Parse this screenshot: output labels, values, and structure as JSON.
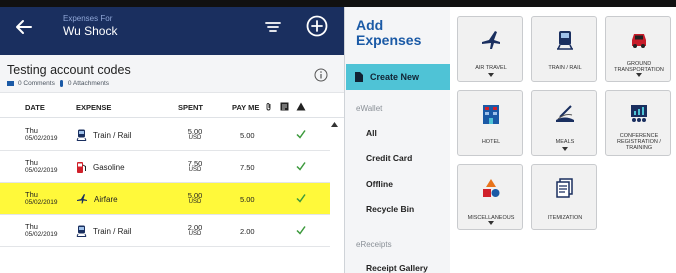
{
  "header": {
    "subtitle": "Expenses For",
    "user_name": "Wu Shock"
  },
  "report": {
    "title": "Testing account codes",
    "comments": "0 Comments",
    "attachments": "0 Attachments"
  },
  "table": {
    "columns": [
      "DATE",
      "EXPENSE",
      "SPENT",
      "PAY ME"
    ],
    "rows": [
      {
        "day": "Thu",
        "date": "05/02/2019",
        "expense": "Train / Rail",
        "icon": "train-icon",
        "spent": "5.00",
        "currency": "USD",
        "pay_me": "5.00",
        "highlight": false
      },
      {
        "day": "Thu",
        "date": "05/02/2019",
        "expense": "Gasoline",
        "icon": "gas-pump-icon",
        "spent": "7.50",
        "currency": "USD",
        "pay_me": "7.50",
        "highlight": false
      },
      {
        "day": "Thu",
        "date": "05/02/2019",
        "expense": "Airfare",
        "icon": "airplane-icon",
        "spent": "5.00",
        "currency": "USD",
        "pay_me": "5.00",
        "highlight": true
      },
      {
        "day": "Thu",
        "date": "05/02/2019",
        "expense": "Train / Rail",
        "icon": "train-icon",
        "spent": "2.00",
        "currency": "USD",
        "pay_me": "2.00",
        "highlight": false
      }
    ]
  },
  "nav": {
    "heading_line1": "Add",
    "heading_line2": "Expenses",
    "create_new": "Create New",
    "ewallet_section": "eWallet",
    "ewallet_items": [
      "All",
      "Credit Card",
      "Offline",
      "Recycle Bin"
    ],
    "ereceipts_section": "eReceipts",
    "ereceipts_items": [
      "Receipt Gallery"
    ]
  },
  "tiles": [
    {
      "label": "AIR TRAVEL",
      "icon": "airplane-icon",
      "has_caret": true
    },
    {
      "label": "TRAIN / RAIL",
      "icon": "train-icon",
      "has_caret": false
    },
    {
      "label": "GROUND TRANSPORTATION",
      "icon": "car-icon",
      "has_caret": true
    },
    {
      "label": "HOTEL",
      "icon": "hotel-icon",
      "has_caret": false
    },
    {
      "label": "MEALS",
      "icon": "meals-icon",
      "has_caret": true
    },
    {
      "label": "CONFERENCE REGISTRATION / TRAINING",
      "icon": "conference-icon",
      "has_caret": false
    },
    {
      "label": "MISCELLANEOUS",
      "icon": "shapes-icon",
      "has_caret": true
    },
    {
      "label": "ITEMIZATION",
      "icon": "itemization-icon",
      "has_caret": false
    }
  ],
  "colors": {
    "topbar": "#1a2f5f",
    "accent": "#4fc3d6",
    "highlight_row": "#fff93a",
    "check": "#3c9a3c",
    "heading": "#1b5aa6"
  }
}
